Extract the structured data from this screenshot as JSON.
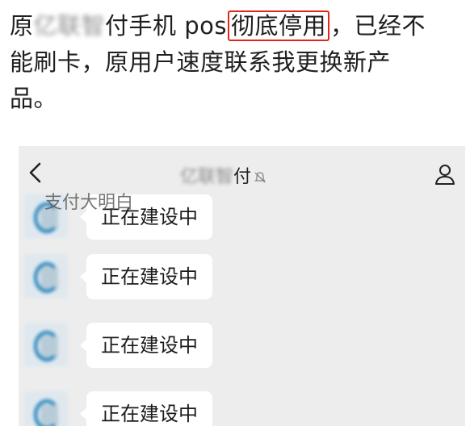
{
  "caption": {
    "line1_pre": "原",
    "line1_blurred": "亿联智",
    "line1_mid": "付手机 pos",
    "line1_highlight": "彻底停用",
    "line1_post": "，已经不",
    "line2": "能刷卡，原用户速度联系我更换新产",
    "line3": "品。"
  },
  "chat": {
    "title_blurred": "亿联智",
    "title_visible": "付",
    "watermark": "支付大明白",
    "messages": [
      {
        "text": "正在建设中"
      },
      {
        "text": "正在建设中"
      },
      {
        "text": "正在建设中"
      },
      {
        "text": "正在建设中"
      }
    ]
  },
  "icons": {
    "back": "chevron-left-icon",
    "mute": "bell-muted-icon",
    "profile": "person-icon"
  },
  "colors": {
    "highlight_border": "#e0261b",
    "chat_background": "#ededed",
    "bubble": "#ffffff"
  }
}
